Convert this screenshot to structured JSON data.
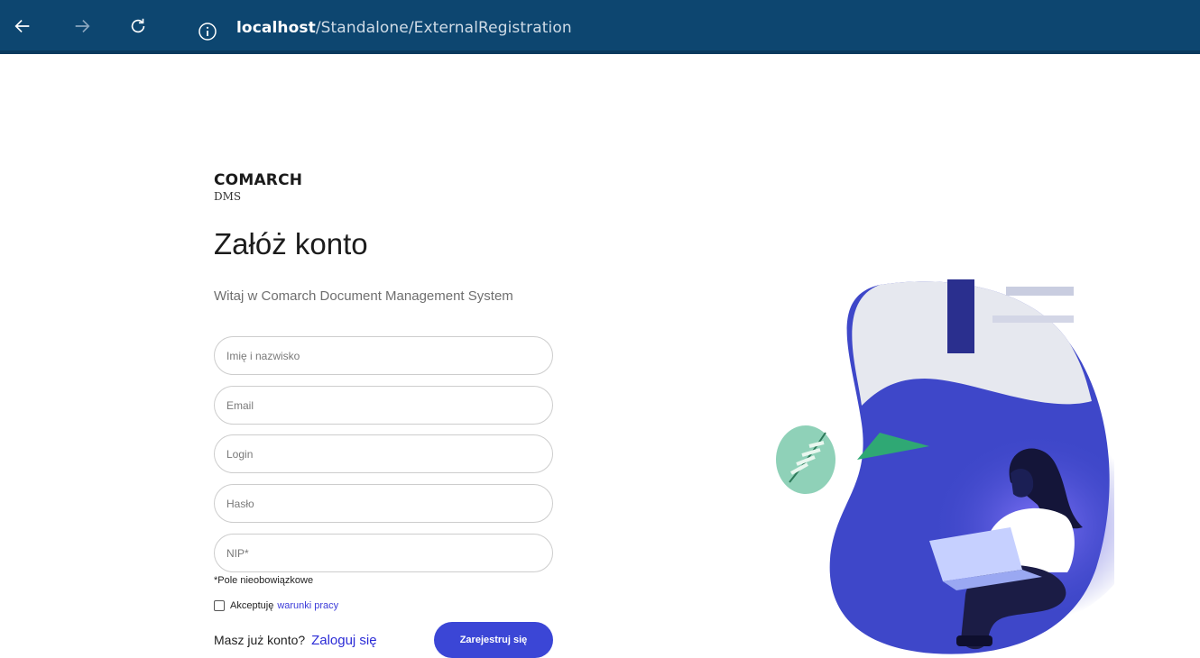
{
  "browser": {
    "url_host": "localhost",
    "url_path": "/Standalone/ExternalRegistration"
  },
  "brand": {
    "name": "COMARCH",
    "product": "DMS"
  },
  "page": {
    "title": "Załóż konto",
    "subtitle": "Witaj w Comarch Document Management System"
  },
  "form": {
    "fields": [
      {
        "placeholder": "Imię i nazwisko",
        "value": ""
      },
      {
        "placeholder": "Email",
        "value": ""
      },
      {
        "placeholder": "Login",
        "value": ""
      },
      {
        "placeholder": "Hasło",
        "value": ""
      },
      {
        "placeholder": "NIP*",
        "value": ""
      }
    ],
    "optional_note": "*Pole nieobowiązkowe",
    "accept_text": "Akceptuję",
    "accept_link": "warunki pracy",
    "accept_checked": false,
    "login_prompt": "Masz już konto?",
    "login_link": "Zaloguj się",
    "register_button": "Zarejestruj się"
  },
  "colors": {
    "browser_bar": "#0d4670",
    "primary_button": "#3b46d6",
    "link": "#2b2bd6",
    "illustration_blue": "#3e47c9"
  },
  "icons": {
    "back": "arrow-left-icon",
    "forward": "arrow-right-icon",
    "refresh": "refresh-icon",
    "info": "info-icon"
  }
}
